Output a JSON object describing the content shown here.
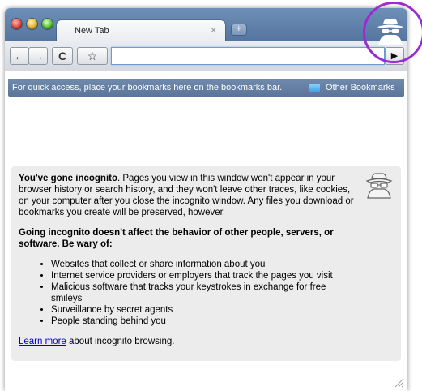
{
  "tab": {
    "title": "New Tab",
    "close_glyph": "×",
    "new_tab_glyph": "+"
  },
  "toolbar": {
    "back_glyph": "←",
    "forward_glyph": "→",
    "reload_glyph": "C",
    "star_glyph": "☆",
    "omnibox_value": "",
    "go_glyph": "▶"
  },
  "bookmarks_bar": {
    "hint": "For quick access, place your bookmarks here on the bookmarks bar.",
    "other_label": "Other Bookmarks"
  },
  "incognito": {
    "intro_bold": "You've gone incognito",
    "intro_rest": ". Pages you view in this window won't appear in your browser history or search history, and they won't leave other traces, like cookies, on your computer after you close the incognito window. Any files you download or bookmarks you create will be preserved, however.",
    "warning": "Going incognito doesn't affect the behavior of other people, servers, or software. Be wary of:",
    "items": [
      "Websites that collect or share information about you",
      "Internet service providers or employers that track the pages you visit",
      "Malicious software that tracks your keystrokes in exchange for free smileys",
      "Surveillance by secret agents",
      "People standing behind you"
    ],
    "learn_more": "Learn more",
    "learn_more_tail": " about incognito browsing."
  },
  "colors": {
    "titlebar": "#5b7ca6",
    "bookmarks_bar": "#6682a6",
    "highlight_ring": "#9b2bd3",
    "link": "#0000cc"
  },
  "icons": [
    "close-icon",
    "plus-icon",
    "back-icon",
    "forward-icon",
    "reload-icon",
    "star-icon",
    "go-icon",
    "folder-icon",
    "incognito-icon",
    "resize-grip-icon"
  ]
}
